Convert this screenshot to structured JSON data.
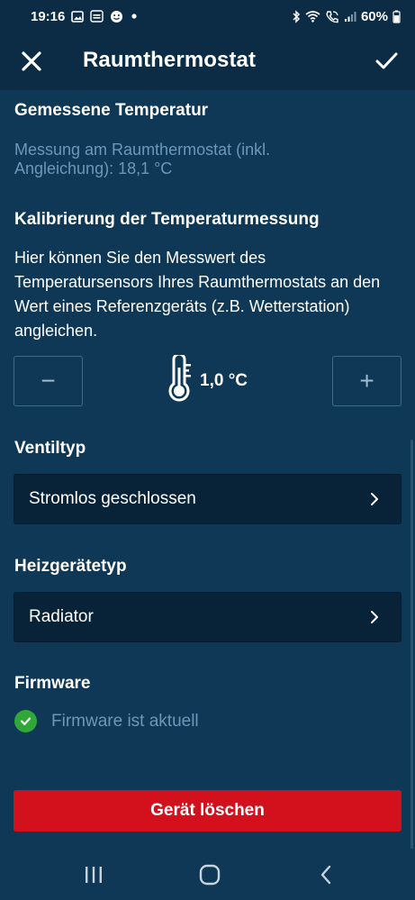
{
  "status_bar": {
    "time": "19:16",
    "battery": "60%",
    "icons_left": [
      "gallery-icon",
      "tagesschau-icon",
      "smiley-icon",
      "dot-icon"
    ],
    "icons_right": [
      "bluetooth-icon",
      "wifi-icon",
      "call-icon",
      "signal-icon",
      "battery-icon"
    ]
  },
  "app_bar": {
    "title": "Raumthermostat"
  },
  "measured": {
    "heading": "Gemessene Temperatur",
    "value_text": "Messung am Raumthermostat (inkl. Angleichung): 18,1 °C"
  },
  "calibration": {
    "heading": "Kalibrierung der Temperaturmessung",
    "description": "Hier können Sie den Messwert des Temperatursensors Ihres Raumthermostats an den Wert eines Referenzgeräts (z.B. Wetterstation) angleichen.",
    "minus_label": "−",
    "plus_label": "+",
    "offset_value": "1,0 °C"
  },
  "valve": {
    "heading": "Ventiltyp",
    "selected": "Stromlos geschlossen"
  },
  "heater": {
    "heading": "Heizgerätetyp",
    "selected": "Radiator"
  },
  "firmware": {
    "heading": "Firmware",
    "status": "Firmware ist aktuell"
  },
  "delete_button": "Gerät löschen",
  "colors": {
    "background": "#0f3856",
    "header": "#0b2c44",
    "muted_text": "#6d96b8",
    "danger": "#d3111d",
    "success": "#2fa838"
  }
}
